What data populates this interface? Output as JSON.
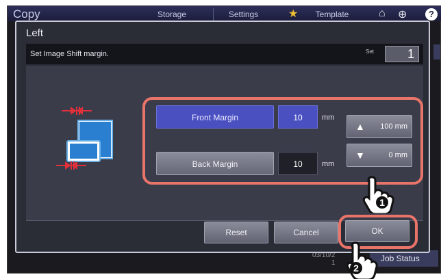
{
  "app": {
    "title": "Copy",
    "tabs": [
      {
        "label": "Storage"
      },
      {
        "label": "Settings"
      },
      {
        "label": "Template"
      }
    ],
    "date_text": "03/10/2",
    "date_sub": "1",
    "job_status_label": "Job Status"
  },
  "dialog": {
    "title": "Left",
    "message": "Set Image Shift margin.",
    "set_label": "Set",
    "set_value": "1",
    "front_margin": {
      "label": "Front Margin",
      "value": "10",
      "unit": "mm"
    },
    "back_margin": {
      "label": "Back Margin",
      "value": "10",
      "unit": "mm"
    },
    "up_limit": "100 mm",
    "down_limit": "0 mm",
    "reset_label": "Reset",
    "cancel_label": "Cancel",
    "ok_label": "OK"
  },
  "callouts": {
    "step1": "1",
    "step2": "2"
  },
  "colors": {
    "accent": "#4a50c0",
    "highlight": "#e8746a",
    "dialog_bg": "#2a2c36"
  }
}
